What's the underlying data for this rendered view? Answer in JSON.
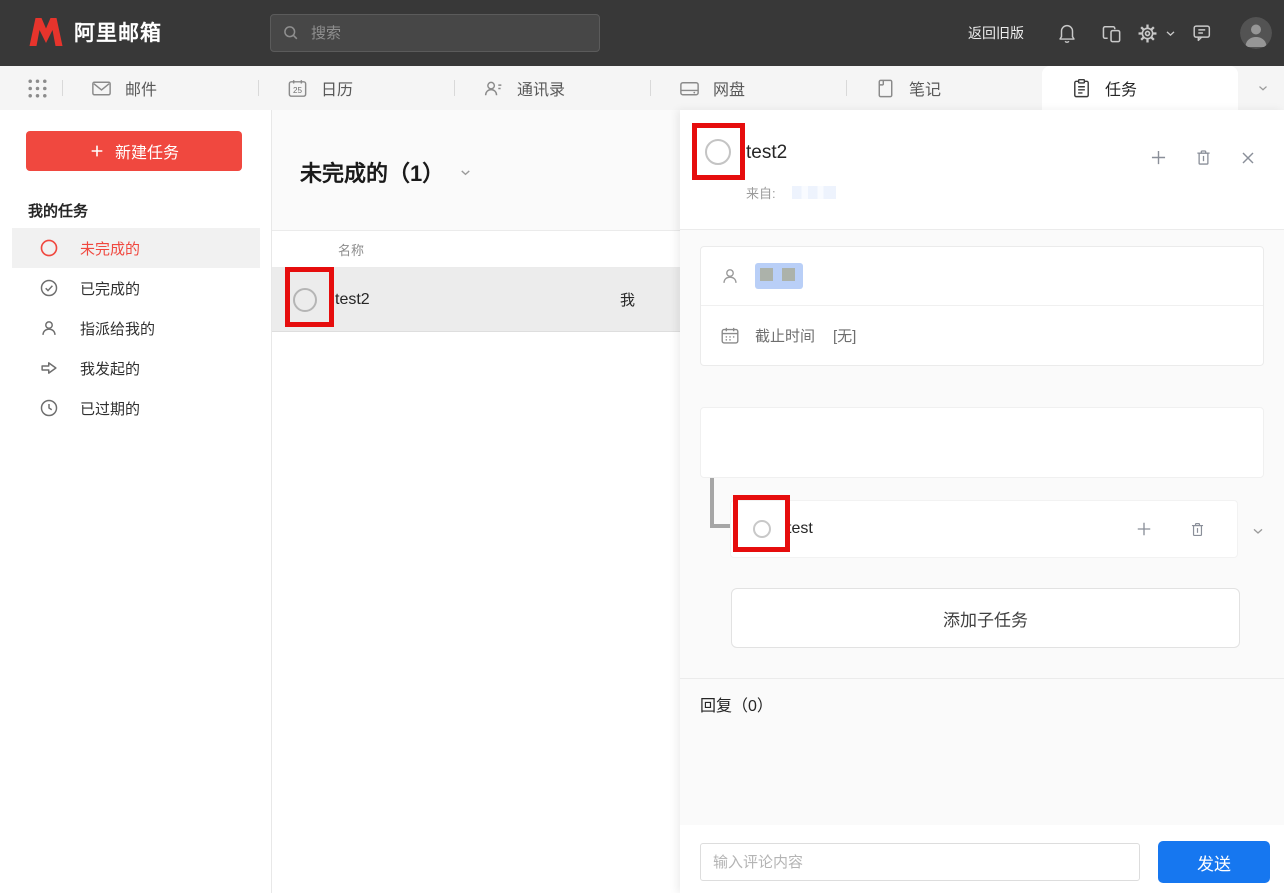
{
  "topbar": {
    "brand": "阿里邮箱",
    "search": {
      "placeholder": "搜索"
    },
    "back_to_old": "返回旧版"
  },
  "tabbar": {
    "tabs": [
      {
        "label": "邮件"
      },
      {
        "label": "日历",
        "calendar_day": "25"
      },
      {
        "label": "通讯录"
      },
      {
        "label": "网盘"
      },
      {
        "label": "笔记"
      },
      {
        "label": "任务",
        "active": true
      }
    ]
  },
  "sidebar": {
    "new_task_button": "新建任务",
    "section_title": "我的任务",
    "items": [
      {
        "label": "未完成的",
        "active": true
      },
      {
        "label": "已完成的"
      },
      {
        "label": "指派给我的"
      },
      {
        "label": "我发起的"
      },
      {
        "label": "已过期的"
      }
    ]
  },
  "task_list": {
    "title": "未完成的（1）",
    "name_column": "名称",
    "rows": [
      {
        "title": "test2",
        "assignee": "我"
      }
    ]
  },
  "task_detail": {
    "title": "test2",
    "from_label": "来自:",
    "deadline_label": "截止时间",
    "deadline_value": "[无]",
    "subtasks": [
      {
        "title": "test"
      }
    ],
    "add_subtask_label": "添加子任务",
    "replies_label": "回复（0）",
    "comment_placeholder": "输入评论内容",
    "send_label": "发送"
  },
  "colors": {
    "topbar_bg": "#383838",
    "accent_red": "#f0483f",
    "annotation_red": "#e60d0d",
    "primary_blue": "#1677f0"
  }
}
